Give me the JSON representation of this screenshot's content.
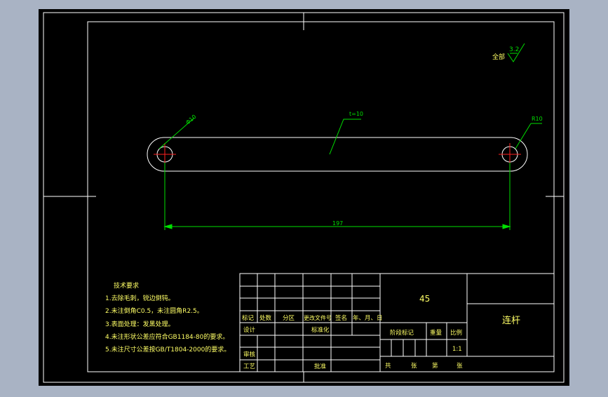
{
  "colors": {
    "background": "#a9b3c4",
    "canvas": "#000000",
    "lines": "#ffffff",
    "dimension": "#00e000",
    "text": "#ffff66",
    "center_lines": "#ff2020"
  },
  "drawing": {
    "roughness": {
      "label": "全部",
      "value": "3.2"
    },
    "dims": {
      "hole_diameter": "Φ10",
      "thickness": "t=10",
      "radius": "R10",
      "length": "197"
    },
    "tech_requirements": {
      "title": "技术要求",
      "items": [
        "1.去除毛刺，锐边倒钝。",
        "2.未注倒角C0.5，未注圆角R2.5。",
        "3.表面处理：发黑处理。",
        "4.未注形状公差应符合GB1184-80的要求。",
        "5.未注尺寸公差按GB/T1804-2000的要求。"
      ]
    },
    "title_block": {
      "material": "45",
      "part_name": "连杆",
      "scale": "1:1",
      "headers": [
        "标记",
        "处数",
        "分区",
        "更改文件号",
        "签名",
        "年、月、日"
      ],
      "design": "设计",
      "standardize": "标准化",
      "review": "审核",
      "process": "工艺",
      "approve": "批准",
      "stage_mark": "阶段标记",
      "weight": "重量",
      "ratio": "比例",
      "total": "共",
      "sheets": "张",
      "page": "第",
      "sheet": "张"
    }
  }
}
